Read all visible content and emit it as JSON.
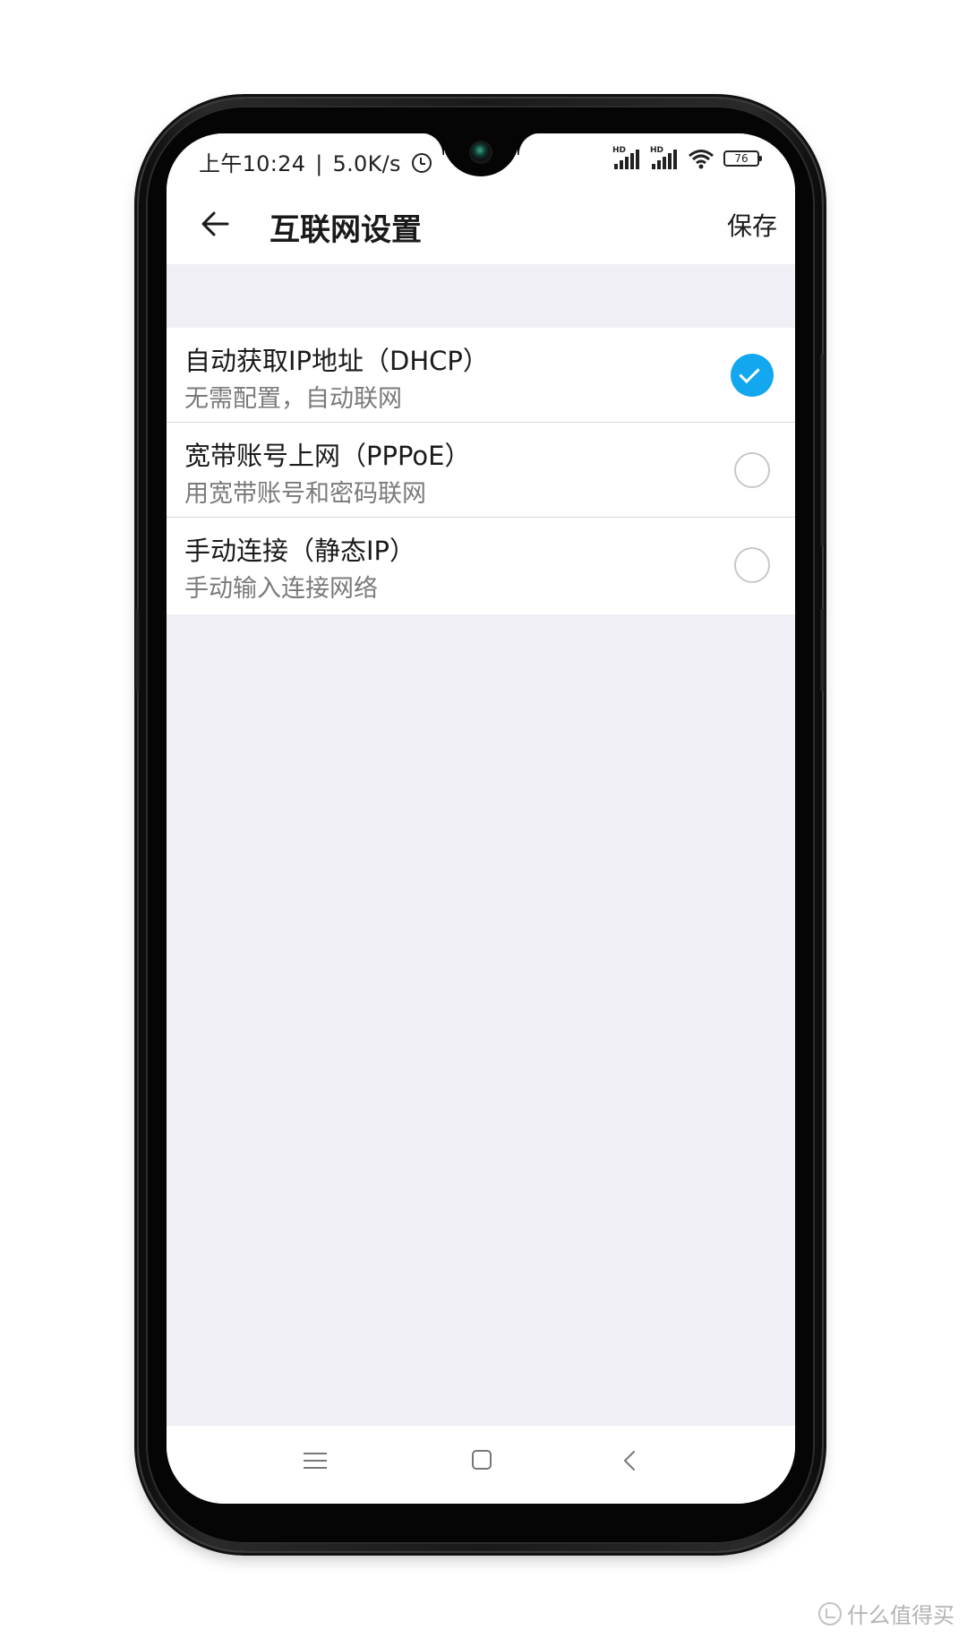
{
  "status_bar": {
    "time": "上午10:24",
    "separator": "|",
    "network_speed": "5.0K/s",
    "alarm_icon": "alarm-clock-icon",
    "signal_labels": [
      "HD",
      "HD"
    ],
    "battery_level": "76"
  },
  "header": {
    "back_icon": "arrow-left-icon",
    "title": "互联网设置",
    "save_label": "保存"
  },
  "options": [
    {
      "title": "自动获取IP地址（DHCP）",
      "subtitle": "无需配置，自动联网",
      "selected": true
    },
    {
      "title": "宽带账号上网（PPPoE）",
      "subtitle": "用宽带账号和密码联网",
      "selected": false
    },
    {
      "title": "手动连接（静态IP）",
      "subtitle": "手动输入连接网络",
      "selected": false
    }
  ],
  "navbar": {
    "icons": [
      "menu-icon",
      "home-square-icon",
      "back-chevron-icon"
    ]
  },
  "colors": {
    "accent": "#12a7ef",
    "screen_background": "#f0eff5",
    "card_background": "#ffffff",
    "primary_text": "#1a1a1a",
    "secondary_text": "#7a7a7a"
  },
  "watermark": {
    "text": "什么值得买"
  }
}
